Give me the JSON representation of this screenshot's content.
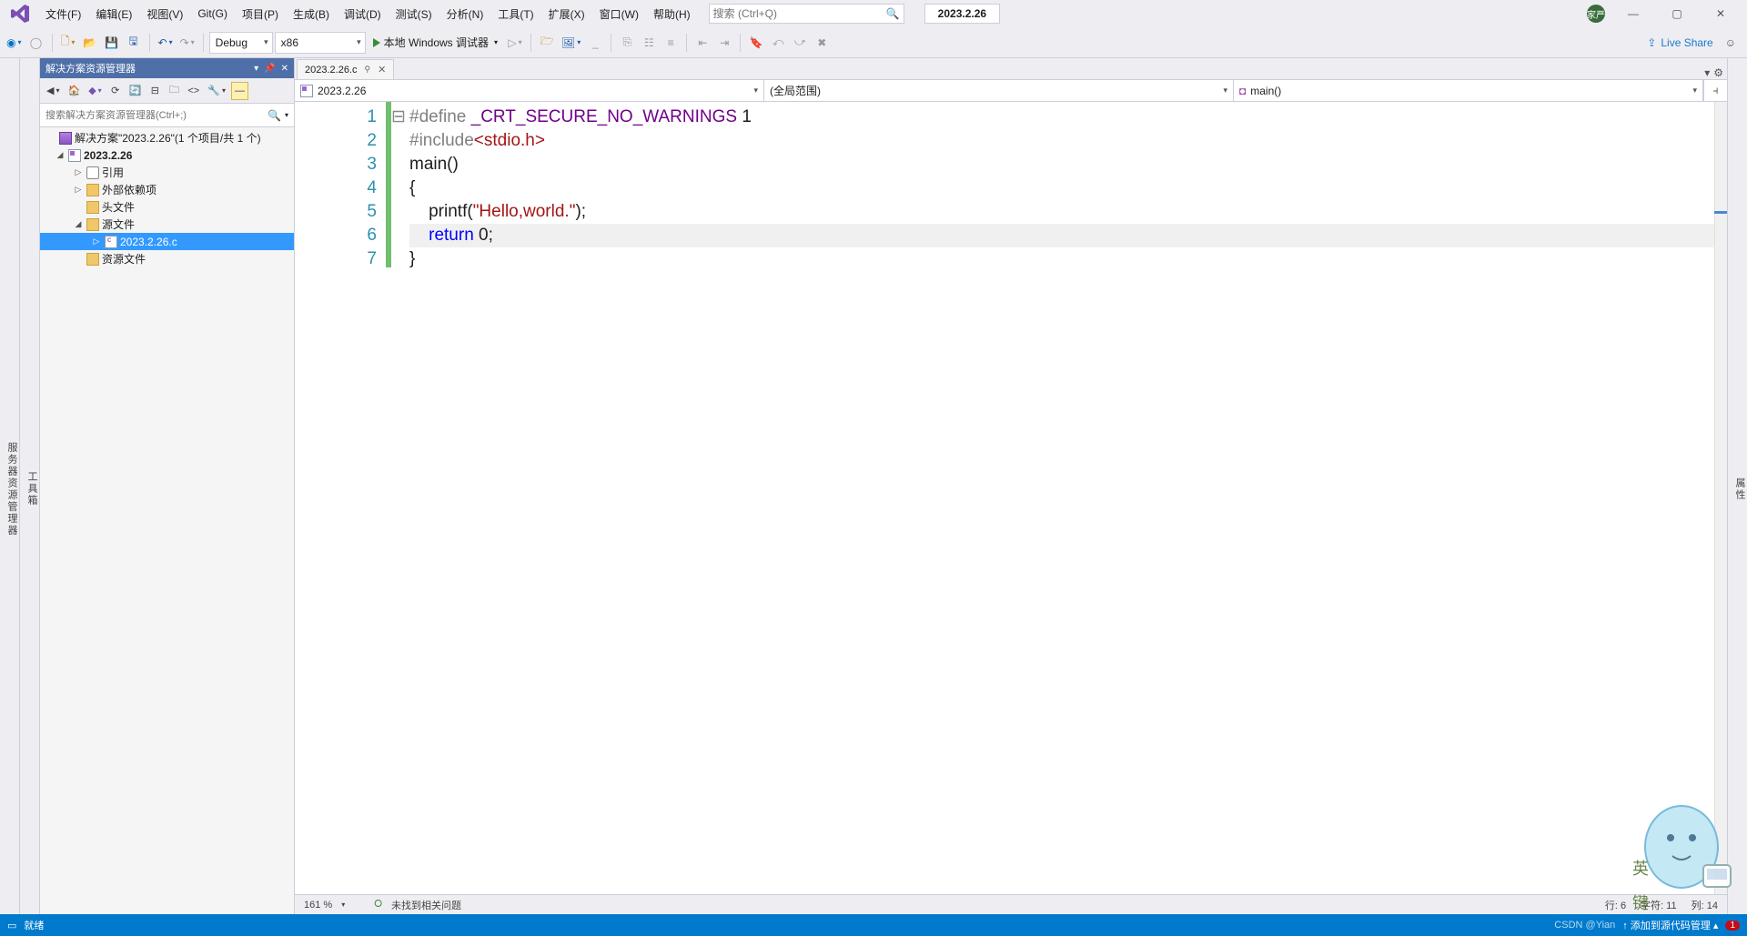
{
  "menu": {
    "items": [
      "文件(F)",
      "编辑(E)",
      "视图(V)",
      "Git(G)",
      "项目(P)",
      "生成(B)",
      "调试(D)",
      "测试(S)",
      "分析(N)",
      "工具(T)",
      "扩展(X)",
      "窗口(W)",
      "帮助(H)"
    ],
    "search_placeholder": "搜索 (Ctrl+Q)",
    "solution_name": "2023.2.26",
    "avatar_text": "家严"
  },
  "toolbar": {
    "config": "Debug",
    "platform": "x86",
    "run_label": "本地 Windows 调试器",
    "live_share": "Live Share"
  },
  "side_rails": {
    "left_top": "服务器资源管理器",
    "left_bottom": "工具箱",
    "right": "属性"
  },
  "sol": {
    "title": "解决方案资源管理器",
    "search_placeholder": "搜索解决方案资源管理器(Ctrl+;)",
    "root": "解决方案\"2023.2.26\"(1 个项目/共 1 个)",
    "project": "2023.2.26",
    "refs": "引用",
    "ext_deps": "外部依赖项",
    "headers": "头文件",
    "sources": "源文件",
    "active_file": "2023.2.26.c",
    "resources": "资源文件"
  },
  "editor": {
    "tab": "2023.2.26.c",
    "nav_scope": "2023.2.26",
    "nav_global": "(全局范围)",
    "nav_func": "main()",
    "zoom": "161 %",
    "issues": "未找到相关问题",
    "status": {
      "line": "行: 6",
      "char": "字符: 11",
      "col": "列: 14"
    },
    "lines": [
      "1",
      "2",
      "3",
      "4",
      "5",
      "6",
      "7"
    ],
    "fold": [
      "",
      "",
      "⊟",
      "",
      "",
      "",
      ""
    ],
    "code": {
      "l1_a": "#define ",
      "l1_b": "_CRT_SECURE_NO_WARNINGS",
      "l1_c": " 1",
      "l2_a": "#include",
      "l2_b": "<stdio.h>",
      "l3": "main()",
      "l4": "{",
      "l5_a": "    printf(",
      "l5_b": "\"Hello,world.\"",
      "l5_c": ");",
      "l6_a": "    ",
      "l6_b": "return",
      "l6_c": " 0;",
      "l7": "}"
    }
  },
  "status": {
    "ready": "就绪",
    "scm": "↑ 添加到源代码管理 ▴",
    "watermark": "CSDN @Yian"
  }
}
